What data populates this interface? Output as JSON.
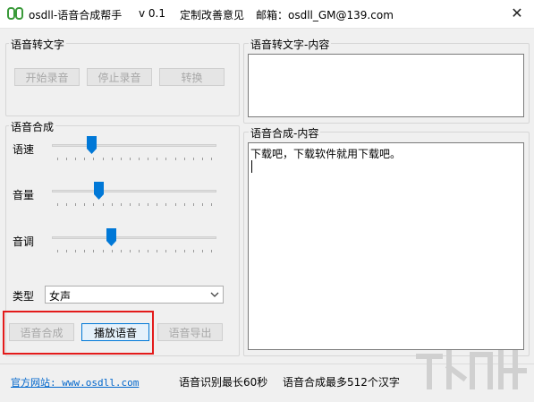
{
  "window": {
    "title": "osdll-语音合成帮手",
    "version": "v 0.1",
    "feedback_label": "定制改善意见",
    "email_label": "邮箱：osdll_GM@139.com",
    "close_label": "✕"
  },
  "stt_group": {
    "title": "语音转文字",
    "start_button": "开始录音",
    "stop_button": "停止录音",
    "convert_button": "转换"
  },
  "stt_content": {
    "title": "语音转文字-内容",
    "text": ""
  },
  "tts_group": {
    "title": "语音合成",
    "sliders": [
      {
        "label": "语速",
        "value_fraction": 0.24
      },
      {
        "label": "音量",
        "value_fraction": 0.28
      },
      {
        "label": "音调",
        "value_fraction": 0.36
      }
    ],
    "type_label": "类型",
    "type_value": "女声",
    "synth_button": "语音合成",
    "play_button": "播放语音",
    "export_button": "语音导出"
  },
  "tts_content": {
    "title": "语音合成-内容",
    "text": "下载吧，下载软件就用下载吧。"
  },
  "footer": {
    "website_link": "官方网站: www.osdll.com",
    "stt_limit": "语音识别最长60秒",
    "tts_limit": "语音合成最多512个汉字"
  },
  "colors": {
    "accent": "#0078d7",
    "highlight": "#e31b1b",
    "app_icon": "#3a9a3a"
  }
}
